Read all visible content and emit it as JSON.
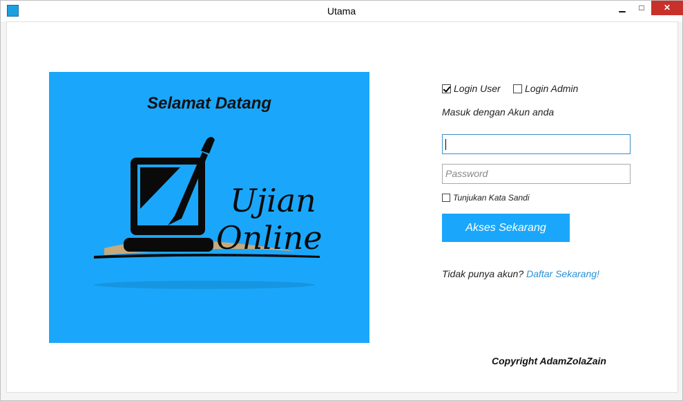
{
  "window": {
    "title": "Utama",
    "minimize_glyph": "▁",
    "maximize_glyph": "□",
    "close_glyph": "✕"
  },
  "banner": {
    "title": "Selamat Datang",
    "logo_line1": "Ujian",
    "logo_line2": "Online",
    "background": "#1aa7fb"
  },
  "login": {
    "login_user_label": "Login User",
    "login_user_checked": true,
    "login_admin_label": "Login Admin",
    "login_admin_checked": false,
    "hint": "Masuk dengan Akun anda",
    "username_value": "",
    "password_placeholder": "Password",
    "show_password_label": "Tunjukan Kata Sandi",
    "access_button": "Akses Sekarang",
    "signup_text": "Tidak punya akun? ",
    "signup_link": "Daftar Sekarang!"
  },
  "footer": {
    "copyright": "Copyright AdamZolaZain"
  },
  "colors": {
    "accent": "#1aa7fb",
    "link": "#2a8fd6",
    "close": "#c7312a"
  }
}
